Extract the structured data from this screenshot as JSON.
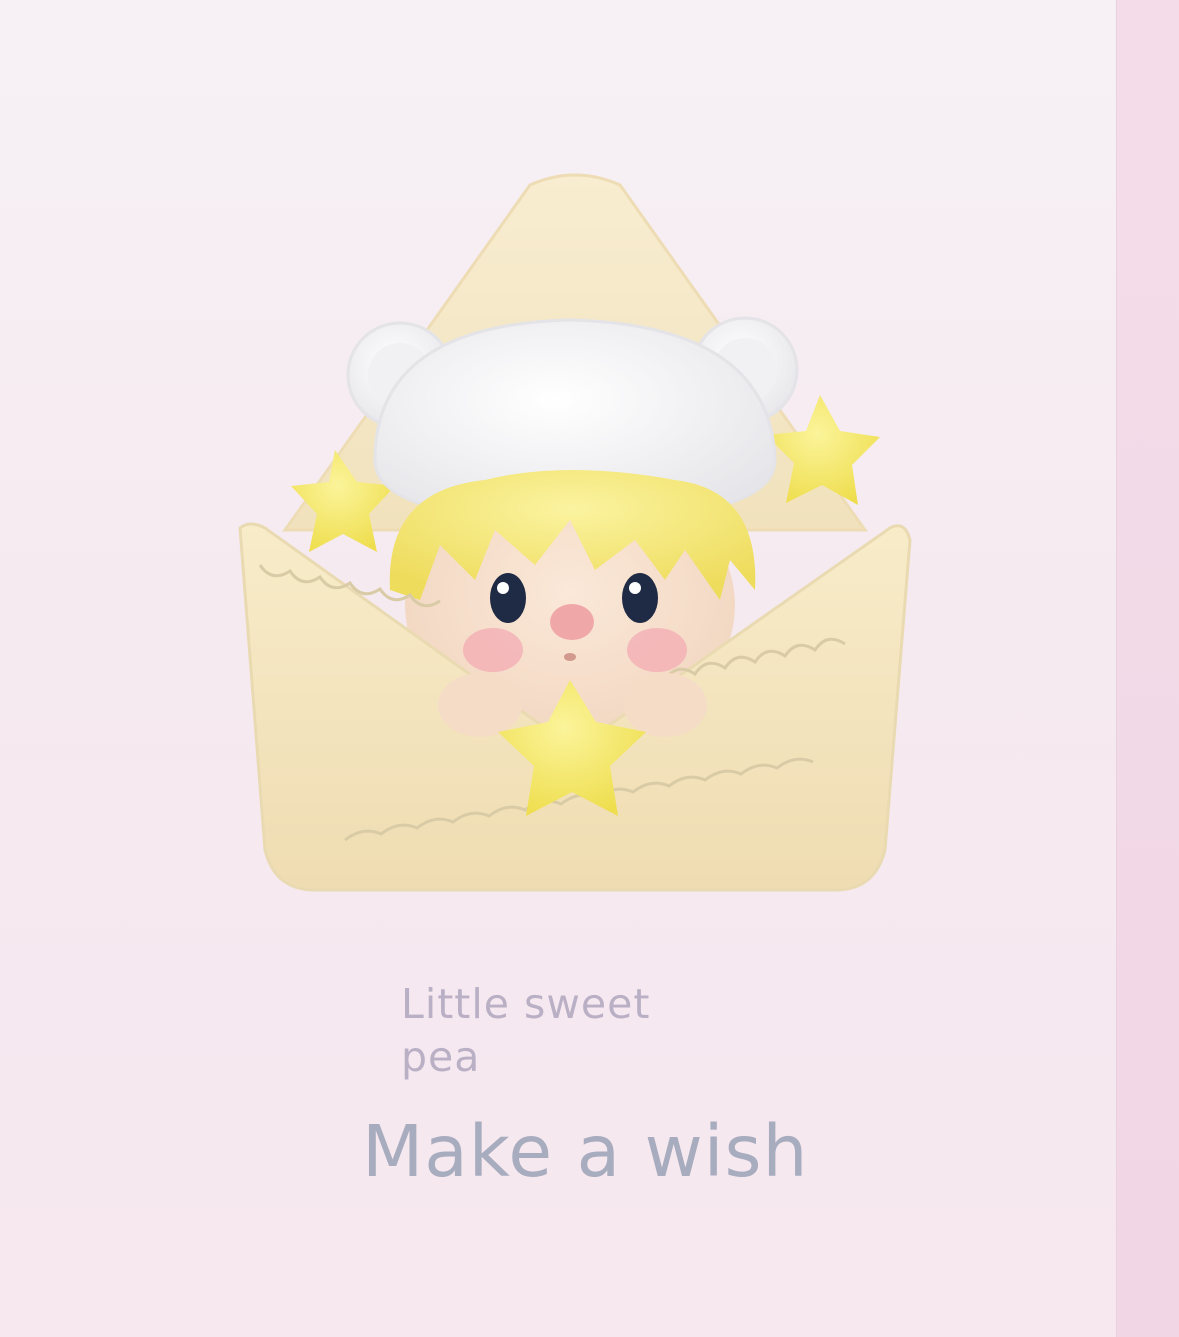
{
  "caption": {
    "subtitle": "Little sweet pea",
    "title": "Make a wish"
  },
  "colors": {
    "background": "#f6edf2",
    "envelope": "#f6e8c5",
    "star": "#f7ea6c",
    "hair": "#f5ea7d",
    "hat": "#f7f7f8",
    "text_subtitle": "#b9b0c6",
    "text_title": "#a7acbe"
  }
}
